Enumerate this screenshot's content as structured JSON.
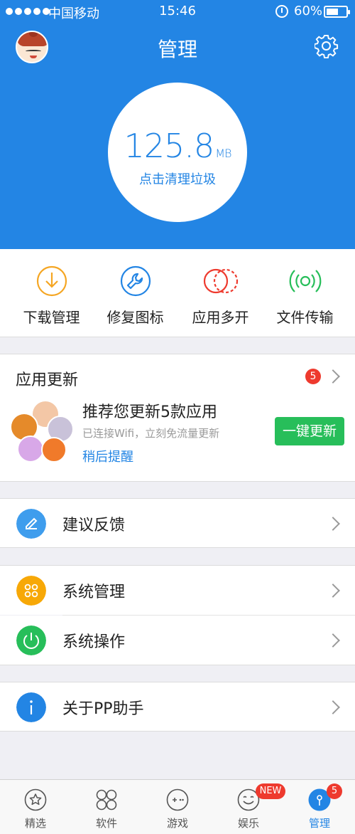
{
  "status_bar": {
    "carrier": "中国移动",
    "time": "15:46",
    "battery_percent": "60%",
    "battery_level": 0.6
  },
  "header": {
    "title": "管理",
    "avatar_icon": "avatar-icon",
    "settings_icon": "gear-icon",
    "background_color": "#2385e4"
  },
  "cleaner": {
    "size_value": "125.8",
    "size_unit": "MB",
    "label": "点击清理垃圾"
  },
  "tools": [
    {
      "label": "下载管理",
      "icon": "download-icon",
      "color": "#f5a623"
    },
    {
      "label": "修复图标",
      "icon": "wrench-icon",
      "color": "#2385e4"
    },
    {
      "label": "应用多开",
      "icon": "multi-open-icon",
      "color": "#ee3a2e"
    },
    {
      "label": "文件传输",
      "icon": "broadcast-icon",
      "color": "#27be5a"
    }
  ],
  "updates": {
    "title": "应用更新",
    "badge_count": "5",
    "headline": "推荐您更新5款应用",
    "subtext": "已连接Wifi，立刻免流量更新",
    "later_link": "稍后提醒",
    "update_button": "一键更新"
  },
  "menu": {
    "feedback": {
      "label": "建议反馈",
      "icon": "pencil-icon",
      "color": "#3f9ded"
    },
    "system_manage": {
      "label": "系统管理",
      "icon": "grid-icon",
      "color": "#f7a807"
    },
    "system_ops": {
      "label": "系统操作",
      "icon": "power-icon",
      "color": "#27be5a"
    },
    "about": {
      "label": "关于PP助手",
      "icon": "info-icon",
      "color": "#2385e4"
    }
  },
  "tabbar": {
    "tabs": [
      {
        "label": "精选",
        "icon": "star-icon"
      },
      {
        "label": "软件",
        "icon": "apps-icon"
      },
      {
        "label": "游戏",
        "icon": "gamepad-icon"
      },
      {
        "label": "娱乐",
        "icon": "smiley-icon",
        "badge": "NEW"
      },
      {
        "label": "管理",
        "icon": "manage-icon",
        "badge": "5",
        "active": true
      }
    ],
    "active_color": "#2385e4"
  }
}
